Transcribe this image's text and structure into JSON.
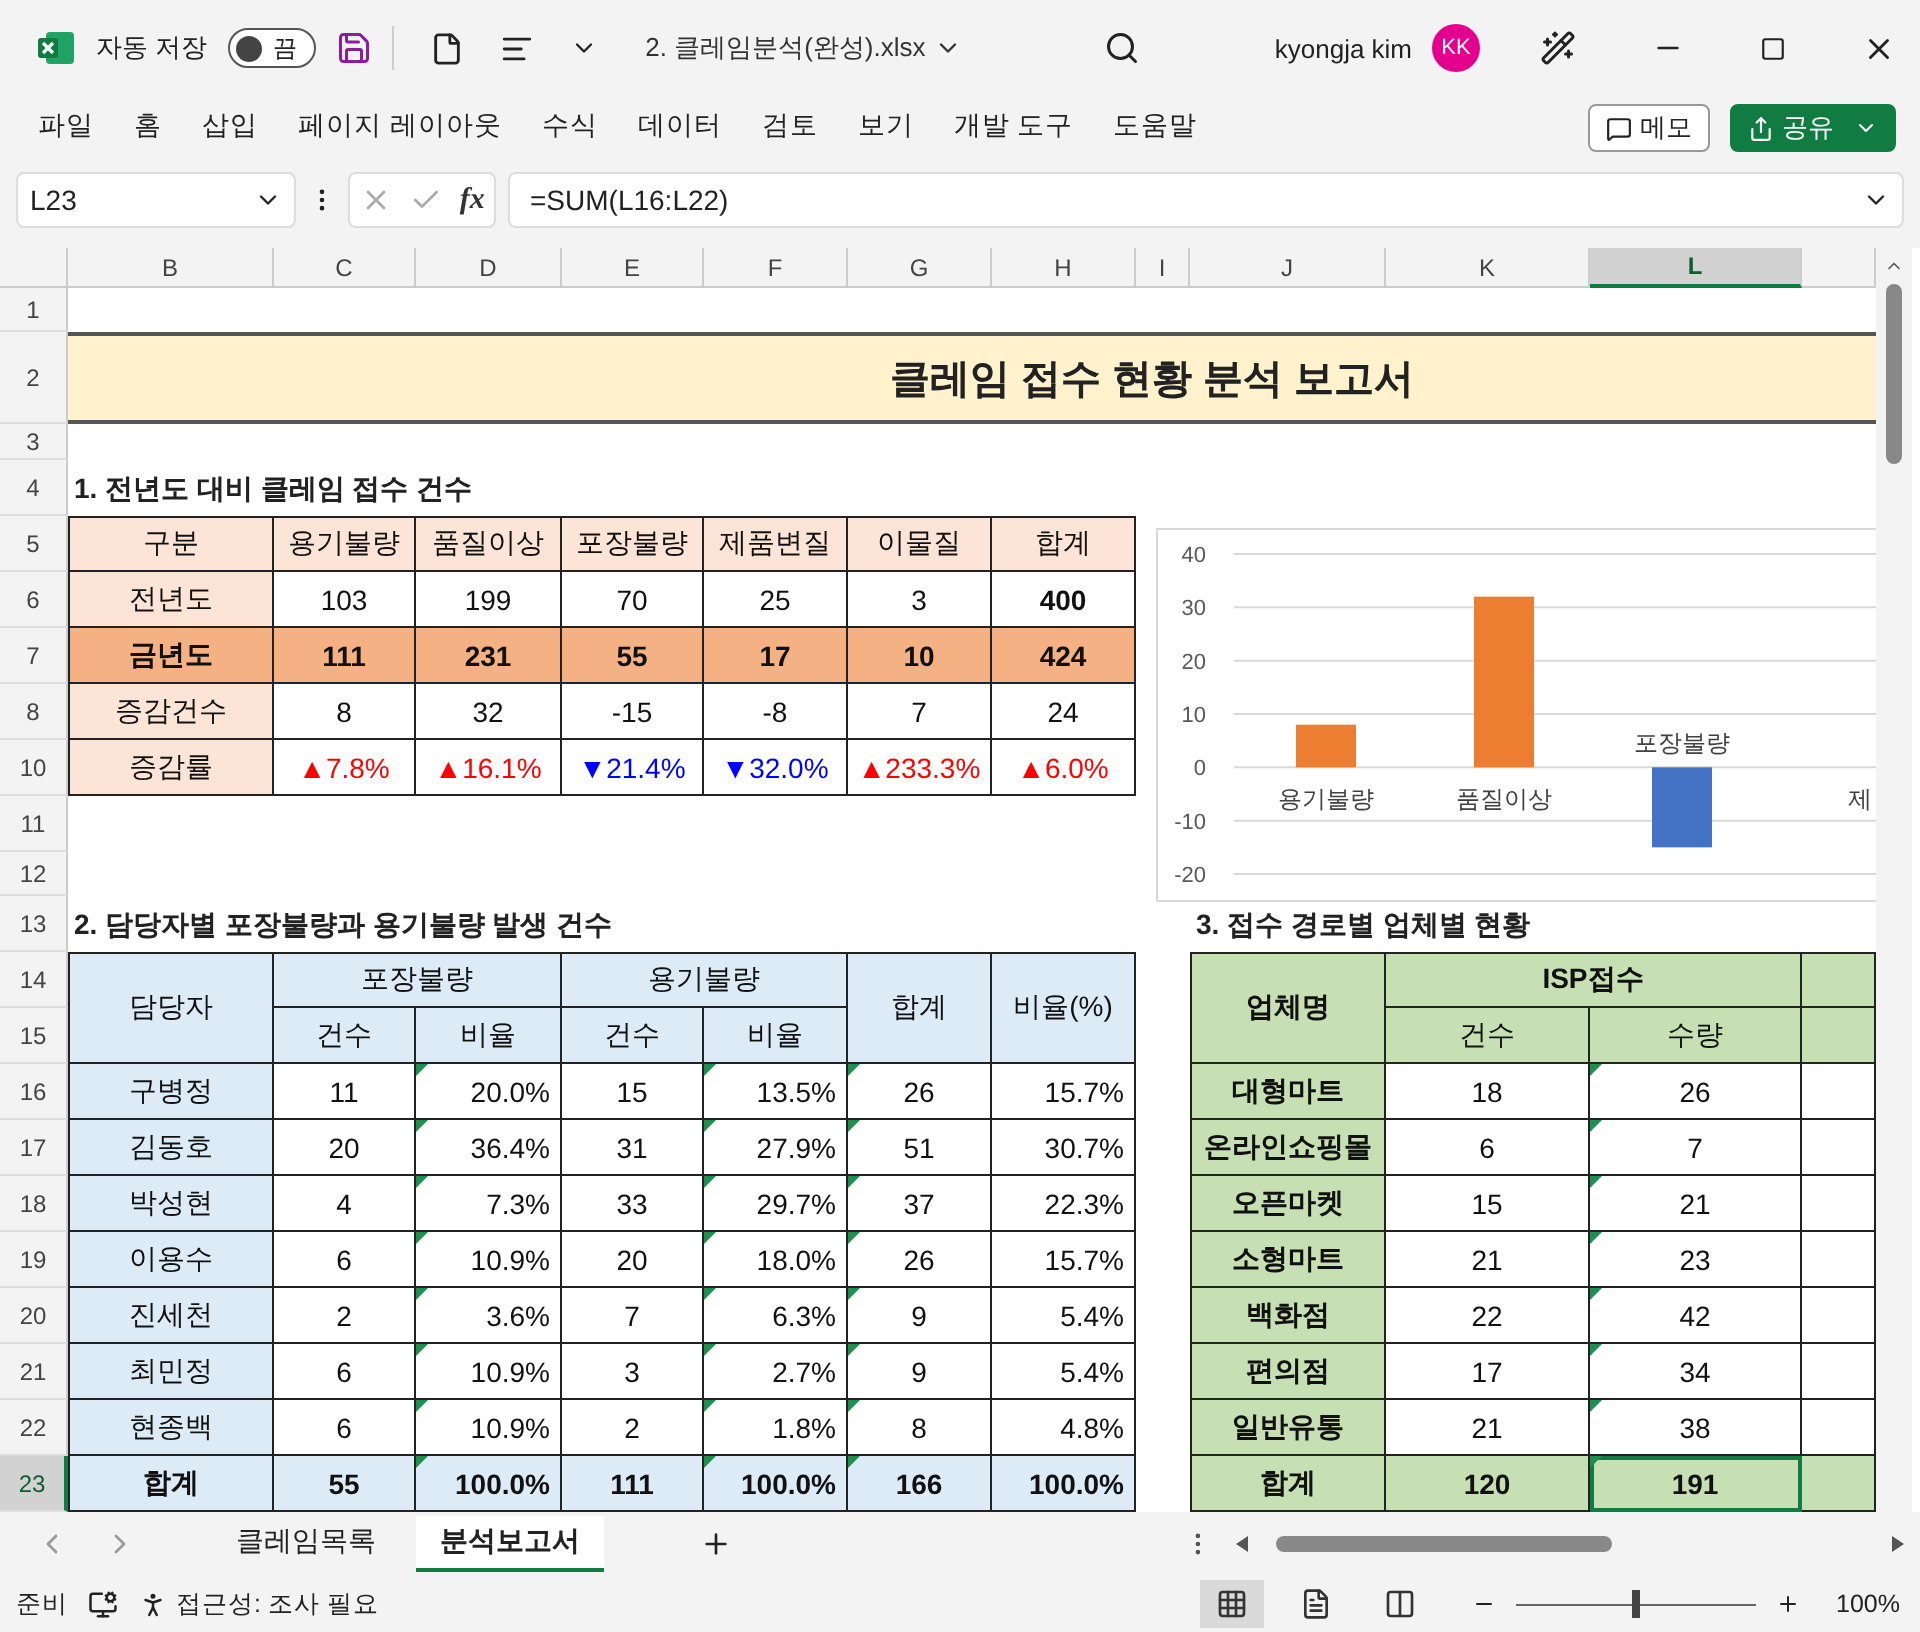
{
  "title_bar": {
    "autosave_label": "자동 저장",
    "autosave": {
      "label": "끔",
      "on": false
    },
    "file_name": "2. 클레임분석(완성).xlsx",
    "user_name": "kyongja kim",
    "avatar": "KK"
  },
  "ribbon_tabs": [
    {
      "label": "파일",
      "selected": false
    },
    {
      "label": "홈",
      "selected": false
    },
    {
      "label": "삽입",
      "selected": false
    },
    {
      "label": "페이지 레이아웃",
      "selected": false
    },
    {
      "label": "수식",
      "selected": false
    },
    {
      "label": "데이터",
      "selected": false
    },
    {
      "label": "검토",
      "selected": false
    },
    {
      "label": "보기",
      "selected": false
    },
    {
      "label": "개발 도구",
      "selected": false
    },
    {
      "label": "도움말",
      "selected": false
    }
  ],
  "ribbon_buttons": [
    {
      "label": "메모",
      "kind": "outline"
    },
    {
      "label": "공유",
      "kind": "primary"
    }
  ],
  "formula_bar": {
    "name_box": "L23",
    "fx": "fx",
    "formula": "=SUM(L16:L22)"
  },
  "sheet": {
    "columns": [
      {
        "label": "B",
        "selected": false
      },
      {
        "label": "C",
        "selected": false
      },
      {
        "label": "D",
        "selected": false
      },
      {
        "label": "E",
        "selected": false
      },
      {
        "label": "F",
        "selected": false
      },
      {
        "label": "G",
        "selected": false
      },
      {
        "label": "H",
        "selected": false
      },
      {
        "label": "I",
        "selected": false
      },
      {
        "label": "J",
        "selected": false
      },
      {
        "label": "K",
        "selected": false
      },
      {
        "label": "L",
        "selected": true
      }
    ],
    "rows": [
      {
        "label": "1",
        "selected": false
      },
      {
        "label": "2",
        "selected": false
      },
      {
        "label": "3",
        "selected": false
      },
      {
        "label": "4",
        "selected": false
      },
      {
        "label": "5",
        "selected": false
      },
      {
        "label": "6",
        "selected": false
      },
      {
        "label": "7",
        "selected": false
      },
      {
        "label": "8",
        "selected": false
      },
      {
        "label": "10",
        "selected": false
      },
      {
        "label": "11",
        "selected": false
      },
      {
        "label": "12",
        "selected": false
      },
      {
        "label": "13",
        "selected": false
      },
      {
        "label": "14",
        "selected": false
      },
      {
        "label": "15",
        "selected": false
      },
      {
        "label": "16",
        "selected": false
      },
      {
        "label": "17",
        "selected": false
      },
      {
        "label": "18",
        "selected": false
      },
      {
        "label": "19",
        "selected": false
      },
      {
        "label": "20",
        "selected": false
      },
      {
        "label": "21",
        "selected": false
      },
      {
        "label": "22",
        "selected": false
      },
      {
        "label": "23",
        "selected": true
      }
    ]
  },
  "report_title": "클레임 접수 현황 분석 보고서",
  "section1": {
    "heading": "1. 전년도 대비 클레임 접수 건수",
    "columns": [
      "구분",
      "용기불량",
      "품질이상",
      "포장불량",
      "제품변질",
      "이물질",
      "합계"
    ],
    "rows": [
      {
        "kind": "count",
        "highlight": false,
        "total_bold": true,
        "cells": [
          "전년도",
          "103",
          "199",
          "70",
          "25",
          "3",
          "400"
        ]
      },
      {
        "kind": "count",
        "highlight": true,
        "cells": [
          "금년도",
          "111",
          "231",
          "55",
          "17",
          "10",
          "424"
        ]
      },
      {
        "kind": "count",
        "highlight": false,
        "total_bold": false,
        "cells": [
          "증감건수",
          "8",
          "32",
          "-15",
          "-8",
          "7",
          "24"
        ]
      },
      {
        "kind": "rate",
        "cells": [
          "증감률",
          {
            "text": "▲7.8%",
            "color": "#ff0000"
          },
          {
            "text": "▲16.1%",
            "color": "#ff0000"
          },
          {
            "text": "▼21.4%",
            "color": "#0000ff"
          },
          {
            "text": "▼32.0%",
            "color": "#0000ff"
          },
          {
            "text": "▲233.3%",
            "color": "#ff0000"
          },
          {
            "text": "▲6.0%",
            "color": "#ff0000"
          }
        ]
      }
    ]
  },
  "chart": {
    "chart_data": {
      "type": "bar",
      "categories": [
        "용기불량",
        "품질이상",
        "포장불량",
        "제"
      ],
      "series": [
        {
          "color": "#ed7d31",
          "values": [
            8,
            32,
            null,
            null
          ]
        },
        {
          "color": "#4472c4",
          "values": [
            null,
            null,
            -15,
            null
          ]
        }
      ],
      "ylim": [
        -20,
        40
      ],
      "yticks": [
        -20,
        -10,
        0,
        10,
        20,
        30,
        40
      ],
      "grid": true
    }
  },
  "section2": {
    "heading": "2. 담당자별 포장불량과 용기불량 발생 건수",
    "header": {
      "name": "담당자",
      "groups": [
        {
          "label": "포장불량",
          "sub": [
            "건수",
            "비율"
          ]
        },
        {
          "label": "용기불량",
          "sub": [
            "건수",
            "비율"
          ]
        }
      ],
      "total": "합계",
      "ratio": "비율(%)"
    },
    "flagged": [
      false,
      true,
      false,
      true,
      true,
      false
    ],
    "rows": [
      {
        "name": "구병정",
        "cells": [
          "11",
          "20.0%",
          "15",
          "13.5%",
          "26",
          "15.7%"
        ]
      },
      {
        "name": "김동호",
        "cells": [
          "20",
          "36.4%",
          "31",
          "27.9%",
          "51",
          "30.7%"
        ]
      },
      {
        "name": "박성현",
        "cells": [
          "4",
          "7.3%",
          "33",
          "29.7%",
          "37",
          "22.3%"
        ]
      },
      {
        "name": "이용수",
        "cells": [
          "6",
          "10.9%",
          "20",
          "18.0%",
          "26",
          "15.7%"
        ]
      },
      {
        "name": "진세천",
        "cells": [
          "2",
          "3.6%",
          "7",
          "6.3%",
          "9",
          "5.4%"
        ]
      },
      {
        "name": "최민정",
        "cells": [
          "6",
          "10.9%",
          "3",
          "2.7%",
          "9",
          "5.4%"
        ]
      },
      {
        "name": "현종백",
        "cells": [
          "6",
          "10.9%",
          "2",
          "1.8%",
          "8",
          "4.8%"
        ]
      }
    ],
    "total": {
      "name": "합계",
      "cells": [
        "55",
        "100.0%",
        "111",
        "100.0%",
        "166",
        "100.0%"
      ]
    }
  },
  "section3": {
    "heading": "3. 접수 경로별 업체별 현황",
    "header": {
      "name": "업체명",
      "group": "ISP접수",
      "sub": [
        "건수",
        "수량"
      ]
    },
    "flagged": [
      false,
      true
    ],
    "rows": [
      {
        "name": "대형마트",
        "cells": [
          "18",
          "26"
        ]
      },
      {
        "name": "온라인쇼핑몰",
        "cells": [
          "6",
          "7"
        ]
      },
      {
        "name": "오픈마켓",
        "cells": [
          "15",
          "21"
        ]
      },
      {
        "name": "소형마트",
        "cells": [
          "21",
          "23"
        ]
      },
      {
        "name": "백화점",
        "cells": [
          "22",
          "42"
        ]
      },
      {
        "name": "편의점",
        "cells": [
          "17",
          "34"
        ]
      },
      {
        "name": "일반유통",
        "cells": [
          "21",
          "38"
        ]
      }
    ],
    "total": {
      "name": "합계",
      "cells": [
        "120",
        "191"
      ]
    }
  },
  "sheet_tabs": [
    {
      "label": "클레임목록",
      "selected": false
    },
    {
      "label": "분석보고서",
      "selected": true
    }
  ],
  "status_bar": {
    "ready": "준비",
    "accessibility": "접근성: 조사 필요",
    "views": [
      {
        "kind": "normal",
        "selected": true
      },
      {
        "kind": "page_layout",
        "selected": false
      },
      {
        "kind": "page_break",
        "selected": false
      }
    ],
    "zoom": {
      "level": 0.5,
      "reading": "100%"
    }
  }
}
